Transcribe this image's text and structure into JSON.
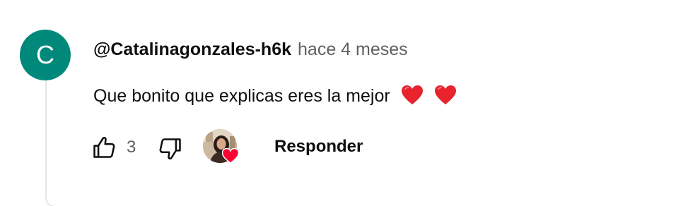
{
  "comment": {
    "avatar_letter": "C",
    "avatar_color": "#00897b",
    "author": "@Catalinagonzales-h6k",
    "time": "hace 4 meses",
    "text": "Que bonito que explicas eres la mejor",
    "emojis": [
      "red-heart",
      "red-heart"
    ]
  },
  "actions": {
    "like_icon": "thumbs-up-icon",
    "like_count": "3",
    "dislike_icon": "thumbs-down-icon",
    "creator_heart_icon": "creator-heart-icon",
    "reply_label": "Responder"
  },
  "colors": {
    "text_primary": "#0f0f0f",
    "text_secondary": "#606060",
    "heart_red": "#ff0033",
    "thread_line": "#e5e5e5"
  }
}
